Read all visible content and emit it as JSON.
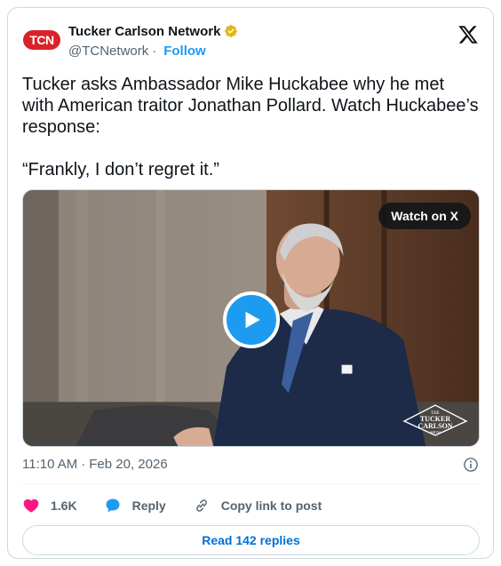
{
  "author": {
    "avatar_text": "TCN",
    "display_name": "Tucker Carlson Network",
    "handle": "@TCNetwork",
    "separator": "·",
    "follow_label": "Follow"
  },
  "tweet": {
    "text": "Tucker asks Ambassador Mike Huckabee why he met with American traitor Jonathan Pollard. Watch Huckabee’s response:\n\n“Frankly, I don’t regret it.”"
  },
  "media": {
    "watch_label": "Watch on X",
    "watermark_top": "THE",
    "watermark_line1": "TUCKER",
    "watermark_line2": "CARLSON",
    "watermark_bottom": "SHOW"
  },
  "meta": {
    "time": "11:10 AM",
    "separator": "·",
    "date": "Feb 20, 2026"
  },
  "actions": {
    "like_count": "1.6K",
    "reply_label": "Reply",
    "copy_label": "Copy link to post"
  },
  "footer": {
    "read_replies_label": "Read 142 replies"
  },
  "icons": {
    "verified": "verified-badge-icon",
    "x_logo": "x-logo-icon",
    "play": "play-icon",
    "info": "info-icon",
    "heart": "heart-icon",
    "reply": "reply-bubble-icon",
    "link": "link-icon"
  },
  "colors": {
    "accent": "#1d9bf0",
    "like": "#f91880",
    "avatar_red": "#d8232a",
    "verified_gold": "#e2b719",
    "link_blue": "#006fd6",
    "muted": "#536471"
  }
}
